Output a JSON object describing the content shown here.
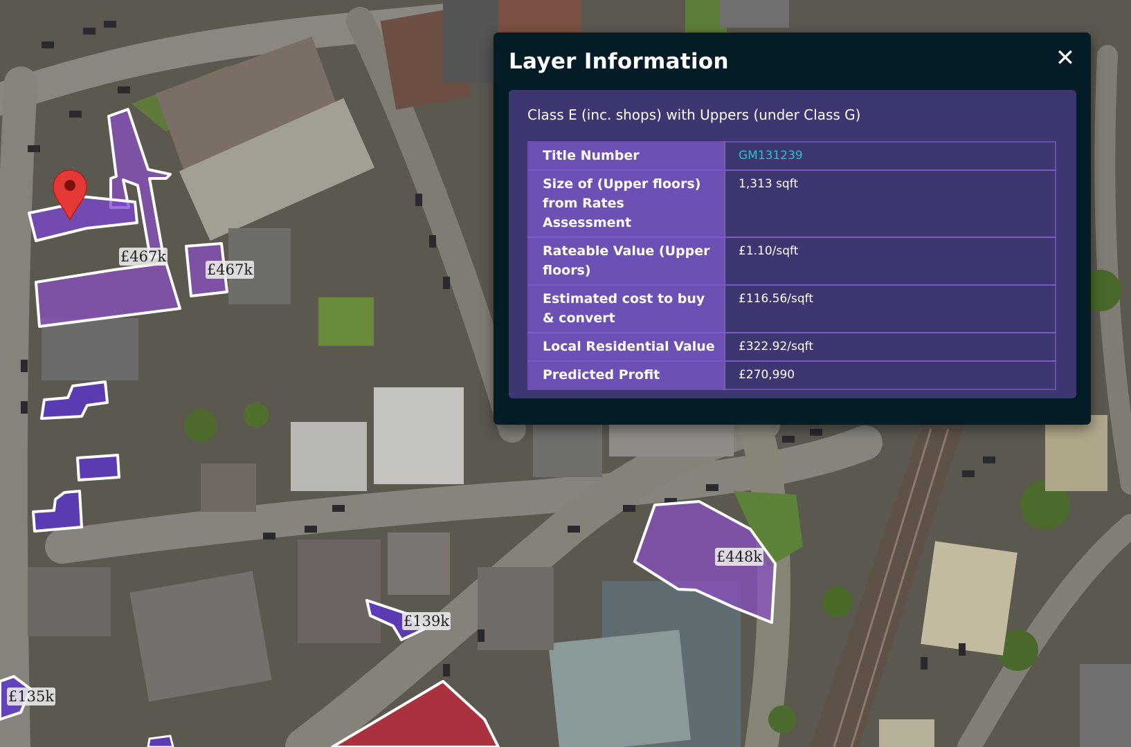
{
  "map": {
    "marker_icon": "map-pin-icon",
    "plots": [
      {
        "label": "£467k"
      },
      {
        "label": "£467k"
      },
      {
        "label": "£448k"
      },
      {
        "label": "£139k"
      },
      {
        "label": "£135k"
      }
    ]
  },
  "panel": {
    "title": "Layer Information",
    "close_icon": "close-icon",
    "close_glyph": "✕",
    "layer_class": "Class E (inc. shops) with Uppers (under Class G)",
    "rows": [
      {
        "key": "Title Number",
        "value": "GM131239"
      },
      {
        "key": "Size of (Upper floors) from Rates Assessment",
        "value": "1,313 sqft"
      },
      {
        "key": "Rateable Value (Upper floors)",
        "value": "£1.10/sqft"
      },
      {
        "key": "Estimated cost to buy & convert",
        "value": "£116.56/sqft"
      },
      {
        "key": "Local Residential Value",
        "value": "£322.92/sqft"
      },
      {
        "key": "Predicted Profit",
        "value": "£270,990"
      }
    ]
  },
  "colors": {
    "panel_bg": "#031c26",
    "panel_body_bg": "#3d3771",
    "key_cell_bg": "#6d50b3",
    "link": "#2fbfc3",
    "plot_fill": "#8a4fc4",
    "plot_fill_blue": "#5a35c8",
    "plot_fill_red": "#c0273a",
    "marker": "#e53935"
  }
}
